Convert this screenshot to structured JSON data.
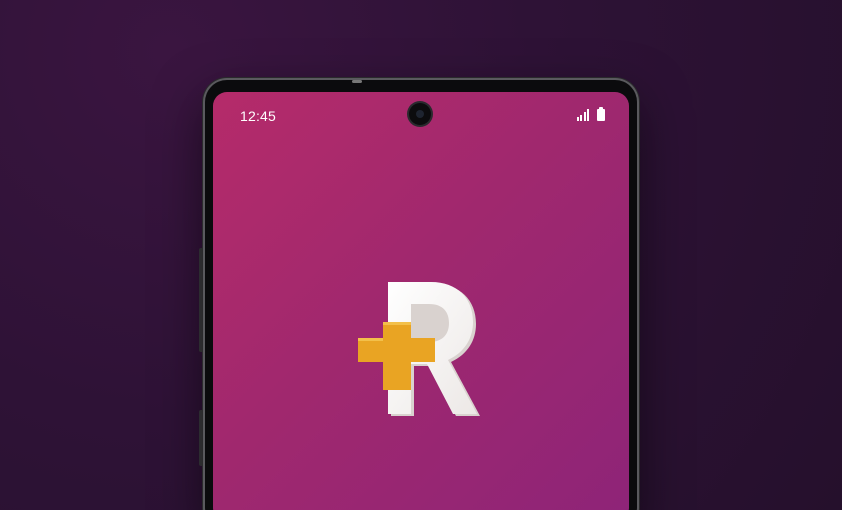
{
  "status_bar": {
    "time": "12:45",
    "signal_icon": "signal-bars-icon",
    "battery_icon": "battery-full-icon"
  },
  "app_logo": {
    "icon": "app-logo-r-plus-icon",
    "letter": "R"
  },
  "colors": {
    "background": "#2e1236",
    "screen_gradient_start": "#b52b6a",
    "screen_gradient_end": "#8e2478",
    "plus_color": "#e9a423",
    "letter_color": "#ffffff"
  }
}
